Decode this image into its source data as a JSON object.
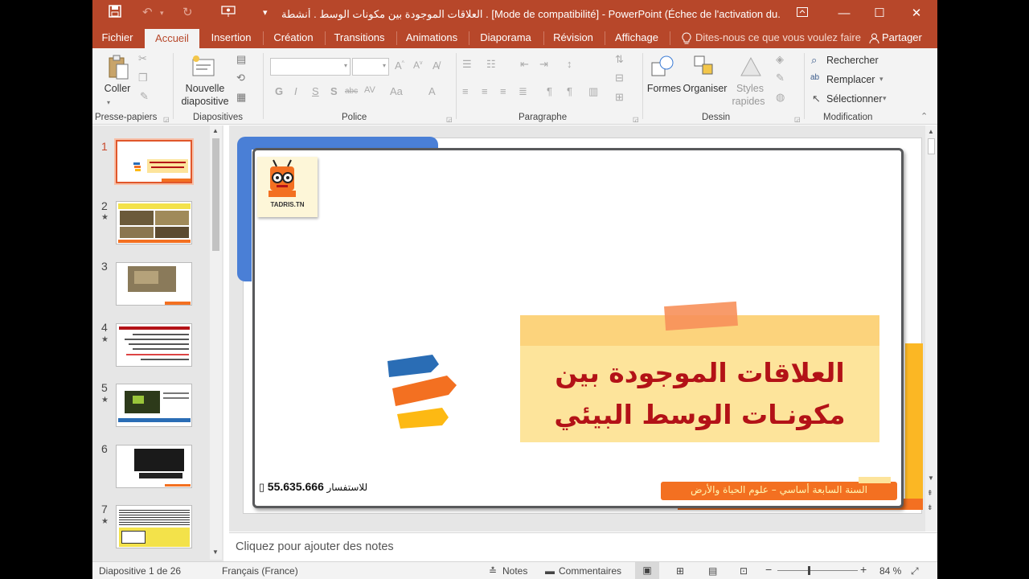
{
  "window": {
    "title": "العلاقات الموجودة بين مكونات الوسط . أنشطة . [Mode de compatibilité] - PowerPoint (Échec de l'activation du...",
    "accent_color": "#b7472a"
  },
  "quick_access": {
    "save_icon": "save-icon",
    "undo_icon": "undo-icon",
    "redo_icon": "redo-icon",
    "present_icon": "present-from-start-icon",
    "customize_icon": "customize-qat-icon"
  },
  "window_controls": {
    "ribbon_options": "ribbon-display-options-icon",
    "minimize": "—",
    "maximize": "☐",
    "close": "✕"
  },
  "tabs": [
    {
      "label": "Fichier"
    },
    {
      "label": "Accueil"
    },
    {
      "label": "Insertion"
    },
    {
      "label": "Création"
    },
    {
      "label": "Transitions"
    },
    {
      "label": "Animations"
    },
    {
      "label": "Diaporama"
    },
    {
      "label": "Révision"
    },
    {
      "label": "Affichage"
    }
  ],
  "tell_me": "Dites-nous ce que vous voulez faire",
  "share": "Partager",
  "ribbon": {
    "clipboard": {
      "paste": "Coller",
      "label": "Presse-papiers"
    },
    "slides": {
      "new_slide_line1": "Nouvelle",
      "new_slide_line2": "diapositive",
      "label": "Diapositives"
    },
    "font": {
      "label": "Police",
      "buttons": [
        "G",
        "I",
        "S",
        "S",
        "abc",
        "AV",
        "Aa",
        "A"
      ]
    },
    "paragraph": {
      "label": "Paragraphe"
    },
    "drawing": {
      "shapes": "Formes",
      "arrange": "Organiser",
      "styles_line1": "Styles",
      "styles_line2": "rapides",
      "label": "Dessin"
    },
    "editing": {
      "find": "Rechercher",
      "replace": "Remplacer",
      "select": "Sélectionner",
      "label": "Modification"
    }
  },
  "thumbnails": [
    {
      "num": "1",
      "star": ""
    },
    {
      "num": "2",
      "star": "★"
    },
    {
      "num": "3",
      "star": ""
    },
    {
      "num": "4",
      "star": "★"
    },
    {
      "num": "5",
      "star": "★"
    },
    {
      "num": "6",
      "star": ""
    },
    {
      "num": "7",
      "star": "★"
    }
  ],
  "slide": {
    "title_line1": "العلاقات الموجودة بين",
    "title_line2": "مكونـات الوسط البيئي",
    "contact_label": "للاستفسار",
    "contact_number": "55.635.666",
    "footer": "السنة السابعة أساسي – علوم الحياة والأرض",
    "logo_text": "TADRIS.TN"
  },
  "notes_placeholder": "Cliquez pour ajouter des notes",
  "status": {
    "slide_info": "Diapositive 1 de 26",
    "language": "Français (France)",
    "notes": "Notes",
    "comments": "Commentaires",
    "zoom": "84 %",
    "zoom_minus": "−",
    "zoom_plus": "+"
  }
}
